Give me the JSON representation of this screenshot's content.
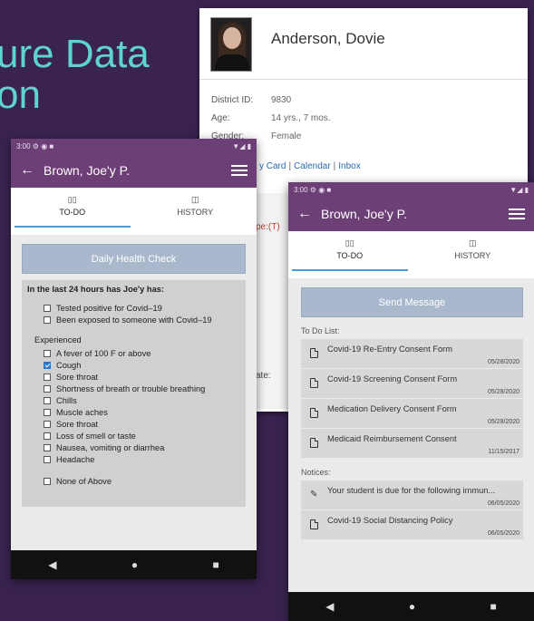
{
  "headline": {
    "line1": "ure Data",
    "line2": "on"
  },
  "desktop": {
    "name": "Anderson, Dovie",
    "fields": [
      {
        "key": "District ID:",
        "value": "9830"
      },
      {
        "key": "Age:",
        "value": "14 yrs., 7 mos."
      },
      {
        "key": "Gender:",
        "value": "Female"
      }
    ],
    "links": {
      "l1": "y Card",
      "l2": "Calendar",
      "l3": "Inbox",
      "sep": "|"
    },
    "partial1": "pe:(T)",
    "partial2": "ate:"
  },
  "phone1": {
    "title": "Brown, Joe'y P.",
    "tabs": {
      "todo": "TO-DO",
      "history": "HISTORY"
    },
    "button": "Daily Health Check",
    "question": "In the last 24 hours has Joe'y has:",
    "group1": [
      {
        "label": "Tested positive for Covid–19",
        "checked": false
      },
      {
        "label": "Been exposed to someone with Covid–19",
        "checked": false
      }
    ],
    "experienced_label": "Experienced",
    "symptoms": [
      {
        "label": "A fever of 100 F or above",
        "checked": false
      },
      {
        "label": "Cough",
        "checked": true
      },
      {
        "label": "Sore throat",
        "checked": false
      },
      {
        "label": "Shortness of breath or trouble breathing",
        "checked": false
      },
      {
        "label": "Chills",
        "checked": false
      },
      {
        "label": "Muscle aches",
        "checked": false
      },
      {
        "label": "Sore throat",
        "checked": false
      },
      {
        "label": "Loss of smell or taste",
        "checked": false
      },
      {
        "label": "Nausea, vomiting or diarrhea",
        "checked": false
      },
      {
        "label": "Headache",
        "checked": false
      }
    ],
    "none_label": "None of Above"
  },
  "phone2": {
    "title": "Brown, Joe'y P.",
    "tabs": {
      "todo": "TO-DO",
      "history": "HISTORY"
    },
    "button": "Send Message",
    "todo_label": "To Do List:",
    "todo_items": [
      {
        "title": "Covid-19 Re-Entry Consent Form",
        "date": "05/28/2020"
      },
      {
        "title": "Covid-19 Screening Consent Form",
        "date": "05/28/2020"
      },
      {
        "title": "Medication Delivery Consent Form",
        "date": "05/28/2020"
      },
      {
        "title": "Medicaid Reimbursement Consent",
        "date": "11/15/2017"
      }
    ],
    "notices_label": "Notices:",
    "notices": [
      {
        "title": "Your student is due for the following immun...",
        "date": "06/05/2020",
        "icon": "pencil-icon"
      },
      {
        "title": "Covid-19 Social Distancing Policy",
        "date": "06/05/2020",
        "icon": "document-icon"
      }
    ]
  },
  "colors": {
    "appbar": "#6d3f77",
    "accent": "#5fd3cf",
    "button": "#a9b8cc",
    "check": "#2f78c8"
  }
}
